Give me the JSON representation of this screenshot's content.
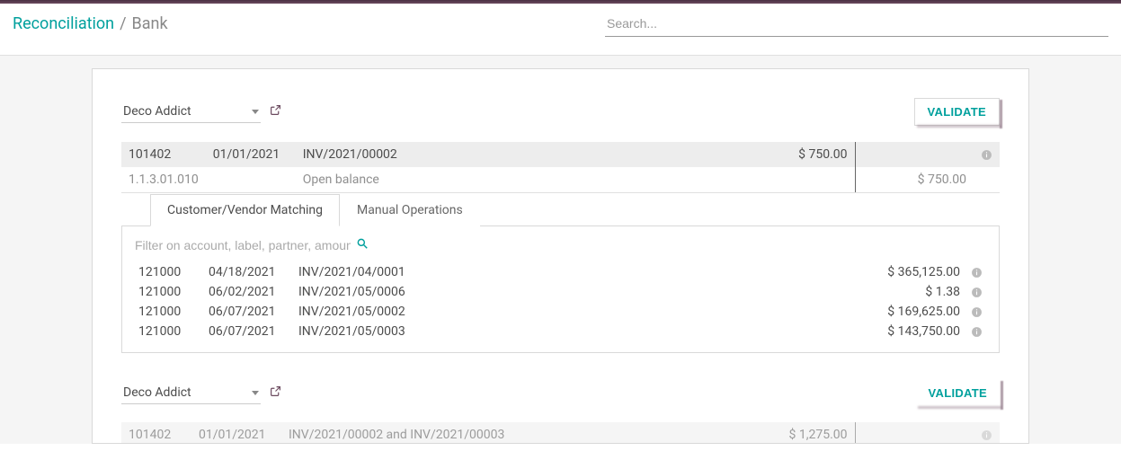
{
  "header": {
    "breadcrumb_link": "Reconciliation",
    "breadcrumb_current": "Bank",
    "search_placeholder": "Search..."
  },
  "blocks": [
    {
      "partner": "Deco Addict",
      "validate_label": "VALIDATE",
      "main_row": {
        "account": "101402",
        "date": "01/01/2021",
        "ref": "INV/2021/00002",
        "amount": "$ 750.00"
      },
      "sub_row": {
        "account": "1.1.3.01.010",
        "ref": "Open balance",
        "amount": "$ 750.00"
      },
      "tabs": [
        "Customer/Vendor Matching",
        "Manual Operations"
      ],
      "active_tab": 0,
      "filter_placeholder": "Filter on account, label, partner, amount,..",
      "matches": [
        {
          "account": "121000",
          "date": "04/18/2021",
          "ref": "INV/2021/04/0001",
          "amount": "$ 365,125.00"
        },
        {
          "account": "121000",
          "date": "06/02/2021",
          "ref": "INV/2021/05/0006",
          "amount": "$ 1.38"
        },
        {
          "account": "121000",
          "date": "06/07/2021",
          "ref": "INV/2021/05/0002",
          "amount": "$ 169,625.00"
        },
        {
          "account": "121000",
          "date": "06/07/2021",
          "ref": "INV/2021/05/0003",
          "amount": "$ 143,750.00"
        }
      ]
    },
    {
      "partner": "Deco Addict",
      "validate_label": "VALIDATE",
      "main_row": {
        "account": "101402",
        "date": "01/01/2021",
        "ref": "INV/2021/00002 and INV/2021/00003",
        "amount": "$ 1,275.00"
      }
    }
  ]
}
